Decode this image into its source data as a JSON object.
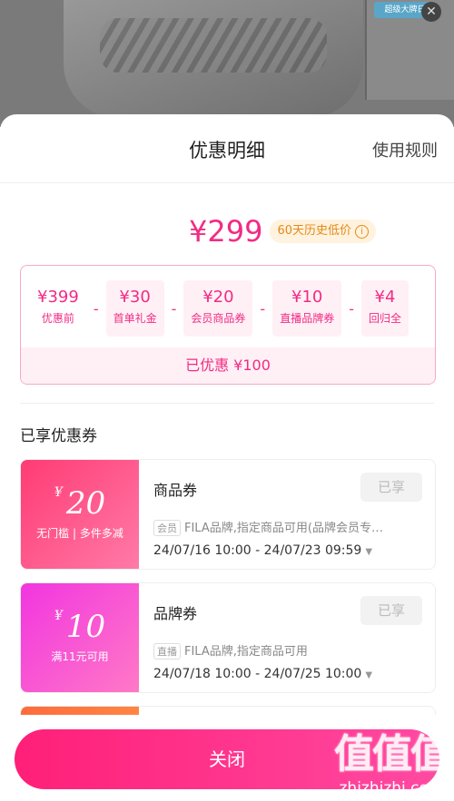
{
  "bg": {
    "thumb_tag": "超级大牌日",
    "close_glyph": "✕"
  },
  "header": {
    "title": "优惠明细",
    "rules_label": "使用规则"
  },
  "price": {
    "final": "¥299",
    "lowest_label": "60天历史低价",
    "info_glyph": "i"
  },
  "breakdown": {
    "items": [
      {
        "amount": "¥399",
        "label": "优惠前"
      },
      {
        "amount": "¥30",
        "label": "首单礼金"
      },
      {
        "amount": "¥20",
        "label": "会员商品券"
      },
      {
        "amount": "¥10",
        "label": "直播品牌券"
      },
      {
        "amount": "¥4",
        "label": "回归全"
      }
    ],
    "minus": "-",
    "saved": "已优惠 ¥100"
  },
  "coupons": {
    "section_title": "已享优惠券",
    "list": [
      {
        "yen": "¥",
        "value": "20",
        "condition": "无门槛 | 多件多减",
        "name": "商品券",
        "status": "已享",
        "tag": "会员",
        "desc": "FILA品牌,指定商品可用(品牌会员专…",
        "date": "24/07/16 10:00 - 24/07/23 09:59"
      },
      {
        "yen": "¥",
        "value": "10",
        "condition": "满11元可用",
        "name": "品牌券",
        "status": "已享",
        "tag": "直播",
        "desc": "FILA品牌,指定商品可用",
        "date": "24/07/18 10:00 - 24/07/25 10:00"
      }
    ],
    "caret": "▼"
  },
  "footer": {
    "close_label": "关闭"
  },
  "watermark": {
    "big": "值值值",
    "small": "zhizhizhi.com"
  },
  "colors": {
    "accent": "#f22b84",
    "lowest": "#e48a17"
  }
}
